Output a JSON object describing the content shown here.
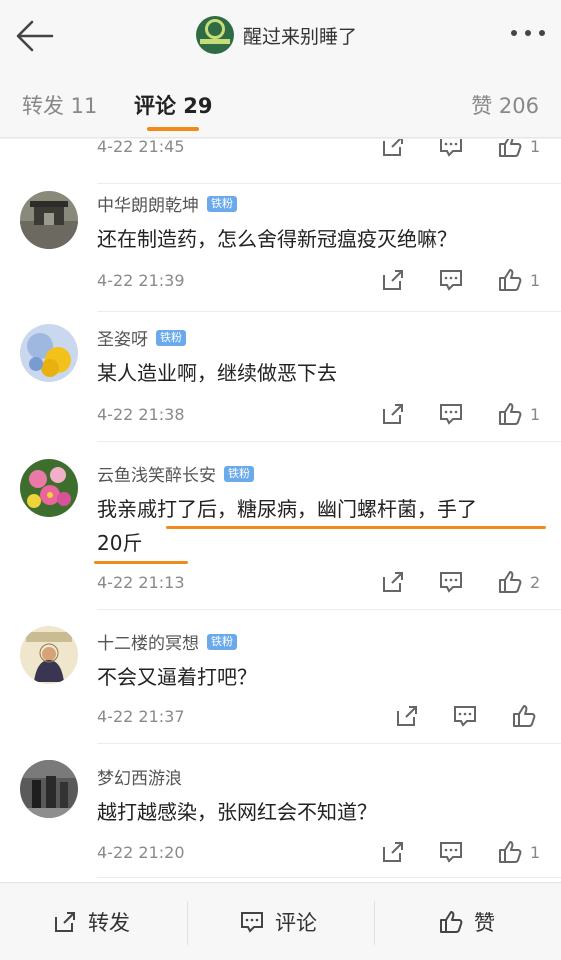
{
  "header": {
    "title": "醒过来别睡了",
    "back_icon": "arrow-left-icon",
    "more_icon": "more-dots-icon"
  },
  "tabs": {
    "repost": "转发 11",
    "comments": "评论 29",
    "likes": "赞 206",
    "active_color": "#f08a1c"
  },
  "comments": [
    {
      "time": "4-22 21:45",
      "likes": "1"
    },
    {
      "user": "中华朗朗乾坤",
      "badge": "铁粉",
      "text": "还在制造药，怎么舍得新冠瘟疫灭绝嘛？",
      "time": "4-22 21:39",
      "likes": "1"
    },
    {
      "user": "圣姿呀",
      "badge": "铁粉",
      "text": "某人造业啊，继续做恶下去",
      "time": "4-22 21:38",
      "likes": "1"
    },
    {
      "user": "云鱼浅笑醉长安",
      "badge": "铁粉",
      "text_line1": "我亲戚打了后，糖尿病，幽门螺杆菌，手了",
      "text_line2": "20斤",
      "time": "4-22 21:13",
      "likes": "2"
    },
    {
      "user": "十二楼的冥想",
      "badge": "铁粉",
      "text": "不会又逼着打吧？",
      "time": "4-22 21:37",
      "likes": ""
    },
    {
      "user": "梦幻西游浪",
      "text": "越打越感染，张网红会不知道？",
      "time": "4-22 21:20",
      "likes": "1"
    }
  ],
  "footer": {
    "repost": "转发",
    "comment": "评论",
    "like": "赞"
  },
  "annotation_color": "#f08a1c"
}
